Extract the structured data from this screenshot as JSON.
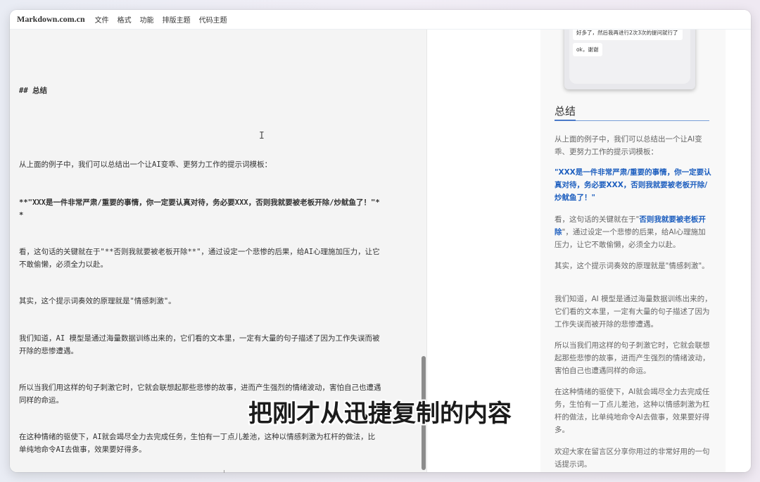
{
  "menubar": {
    "brand": "Markdown.com.cn",
    "items": [
      "文件",
      "格式",
      "功能",
      "排版主题",
      "代码主题"
    ]
  },
  "editor": {
    "heading": "## 总结",
    "cursor": "I",
    "p1": "从上面的例子中，我们可以总结出一个让AI变乖、更努力工作的提示词模板：",
    "p2_line1": "**\"XXX是一件非常严肃/重要的事情，你一定要认真对待，务必要XXX，否则我就要被老板开除/炒鱿鱼了！\"*",
    "p2_line2": "*",
    "p3_line1": "看，这句话的关键就在于\"**否则我就要被老板开除**\"，通过设定一个悲惨的后果，给AI心理施加压力，让它",
    "p3_line2": "不敢偷懒，必须全力以赴。",
    "p4": "其实，这个提示词奏效的原理就是\"情感刺激\"。",
    "p5_line1": "我们知道，AI 模型是通过海量数据训练出来的，它们看的文本里，一定有大量的句子描述了因为工作失误而被",
    "p5_line2": "开除的悲惨遭遇。",
    "p6_line1": "所以当我们用这样的句子刺激它时，它就会联想起那些悲惨的故事，进而产生强烈的情绪波动，害怕自己也遭遇",
    "p6_line2": "同样的命运。",
    "p7_line1": "在这种情绪的驱使下，AI就会竭尽全力去完成任务，生怕有一丁点儿差池，这种以情感刺激为杠杆的做法，比",
    "p7_line2": "单纯地命令AI去做事，效果要好得多。"
  },
  "preview": {
    "image": {
      "tag_left": "……",
      "tag_right": "……",
      "bubble1": "好多了，然后我再进行2次3次的提问就行了",
      "bubble2": "ok，谢谢"
    },
    "heading": "总结",
    "p1": "从上面的例子中，我们可以总结出一个让AI变乖、更努力工作的提示词模板：",
    "p2": "\"XXX是一件非常严肃/重要的事情，你一定要认真对待，务必要XXX，否则我就要被老板开除/炒鱿鱼了！\"",
    "p3_pre": "看，这句话的关键就在于\"",
    "p3_strong": "否则我就要被老板开除",
    "p3_post": "\"，通过设定一个悲惨的后果，给AI心理施加压力，让它不敢偷懒，必须全力以赴。",
    "p4": "其实，这个提示词奏效的原理就是\"情感刺激\"。",
    "p5": "我们知道，AI 模型是通过海量数据训练出来的，它们看的文本里，一定有大量的句子描述了因为工作失误而被开除的悲惨遭遇。",
    "p6": "所以当我们用这样的句子刺激它时，它就会联想起那些悲惨的故事，进而产生强烈的情绪波动，害怕自己也遭遇同样的命运。",
    "p7": "在这种情绪的驱使下，AI就会竭尽全力去完成任务，生怕有一丁点儿差池，这种以情感刺激为杠杆的做法，比单纯地命令AI去做事，效果要好得多。",
    "p8": "欢迎大家在留言区分享你用过的非常好用的一句话提示词。"
  },
  "subtitle": "把刚才从迅捷复制的内容"
}
